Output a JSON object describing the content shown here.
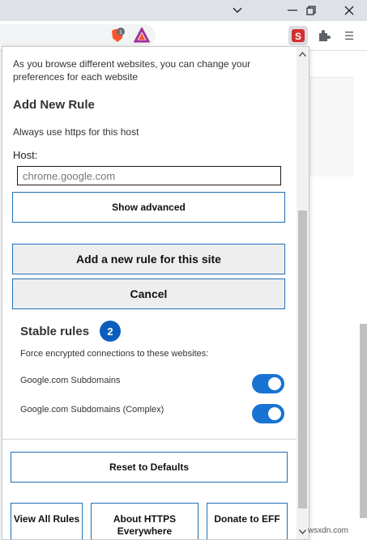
{
  "popup": {
    "intro_text": "As you browse different websites, you can change your preferences for each website",
    "add_rule_heading": "Add New Rule",
    "https_text": "Always use https for this host",
    "host_label": "Host:",
    "host_value": "chrome.google.com",
    "show_advanced_label": "Show advanced",
    "add_rule_label": "Add a new rule for this site",
    "cancel_label": "Cancel",
    "stable_rules_heading": "Stable rules",
    "stable_rules_count": "2",
    "force_text": "Force encrypted connections to these websites:",
    "rules": [
      {
        "name": "Google.com Subdomains",
        "enabled": true
      },
      {
        "name": "Google.com Subdomains (Complex)",
        "enabled": true
      }
    ],
    "reset_label": "Reset to Defaults",
    "view_all_label": "View All Rules",
    "about_label": "About HTTPS Everywhere",
    "donate_label": "Donate to EFF"
  },
  "watermark": "wsxdn.com",
  "colors": {
    "accent": "#1f6fb5",
    "badge": "#0c5ebd",
    "toggle_on": "#1873d3",
    "extension_red": "#d32f2f"
  },
  "icons": [
    "minimize-icon",
    "restore-icon",
    "close-icon",
    "brave-shields-icon",
    "brave-rewards-icon",
    "https-everywhere-icon",
    "puzzle-icon",
    "menu-icon"
  ]
}
